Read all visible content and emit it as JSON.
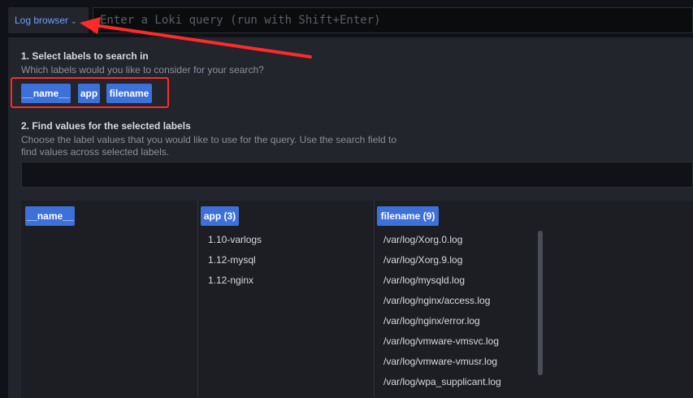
{
  "query_bar": {
    "log_browser_label": "Log browser",
    "log_browser_chevron": "⌄",
    "query_placeholder": "Enter a Loki query (run with Shift+Enter)"
  },
  "step1": {
    "title": "1. Select labels to search in",
    "description": "Which labels would you like to consider for your search?",
    "labels": [
      "__name__",
      "app",
      "filename"
    ]
  },
  "step2": {
    "title": "2. Find values for the selected labels",
    "description": "Choose the label values that you would like to use for the query. Use the search field to find values across selected labels.",
    "search_value": ""
  },
  "value_columns": [
    {
      "header": "__name__",
      "values": []
    },
    {
      "header": "app (3)",
      "values": [
        "1.10-varlogs",
        "1.12-mysql",
        "1.12-nginx"
      ]
    },
    {
      "header": "filename (9)",
      "values": [
        "/var/log/Xorg.0.log",
        "/var/log/Xorg.9.log",
        "/var/log/mysqld.log",
        "/var/log/nginx/access.log",
        "/var/log/nginx/error.log",
        "/var/log/vmware-vmsvc.log",
        "/var/log/vmware-vmusr.log",
        "/var/log/wpa_supplicant.log"
      ]
    }
  ],
  "colors": {
    "accent": "#3d71d9",
    "link": "#6e9fff",
    "annotation": "#ff2a2a",
    "panel_bg": "#22252b",
    "page_bg": "#111217"
  }
}
